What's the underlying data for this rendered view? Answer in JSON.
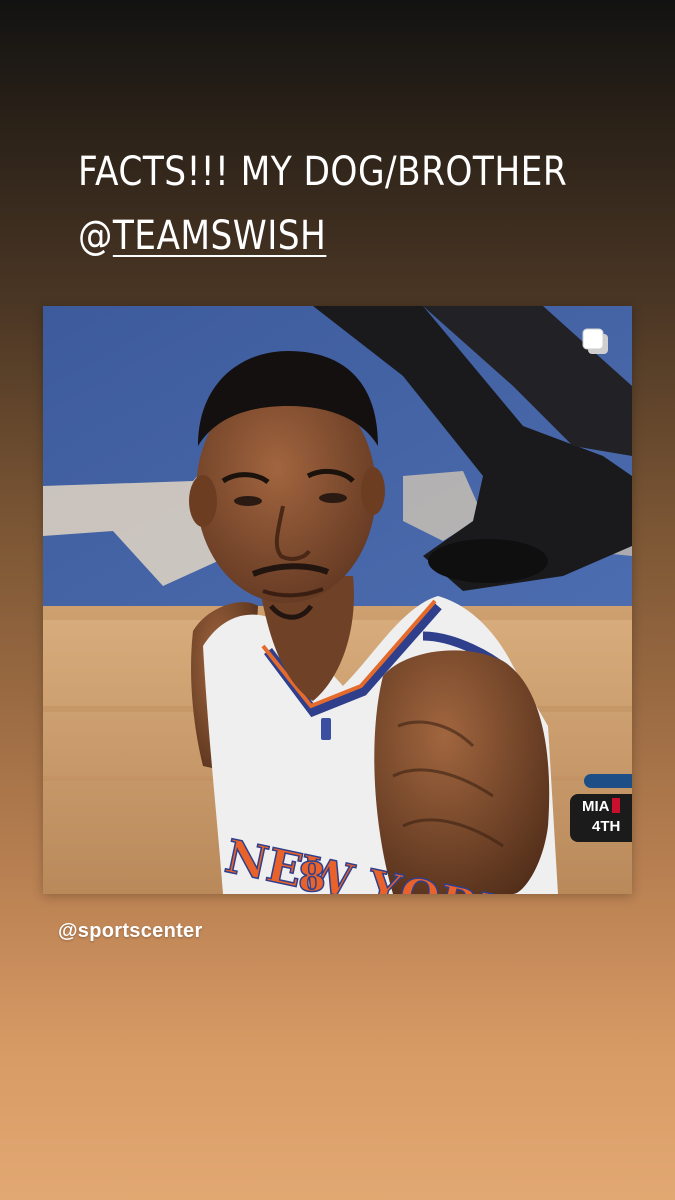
{
  "story": {
    "caption_line1": "FACTS!!! MY DOG/BROTHER",
    "caption_at": "@",
    "caption_mention": "TEAMSWISH",
    "background_colors": [
      "#121212",
      "#4a3624",
      "#9e6d44",
      "#e2a873"
    ]
  },
  "shared_post": {
    "attribution": "@sportscenter",
    "multi_media_icon": "carousel-icon",
    "score_bug": {
      "team": "MIA",
      "period": "4TH"
    },
    "jersey_text": "NEW YORK",
    "jersey_number": "8"
  }
}
